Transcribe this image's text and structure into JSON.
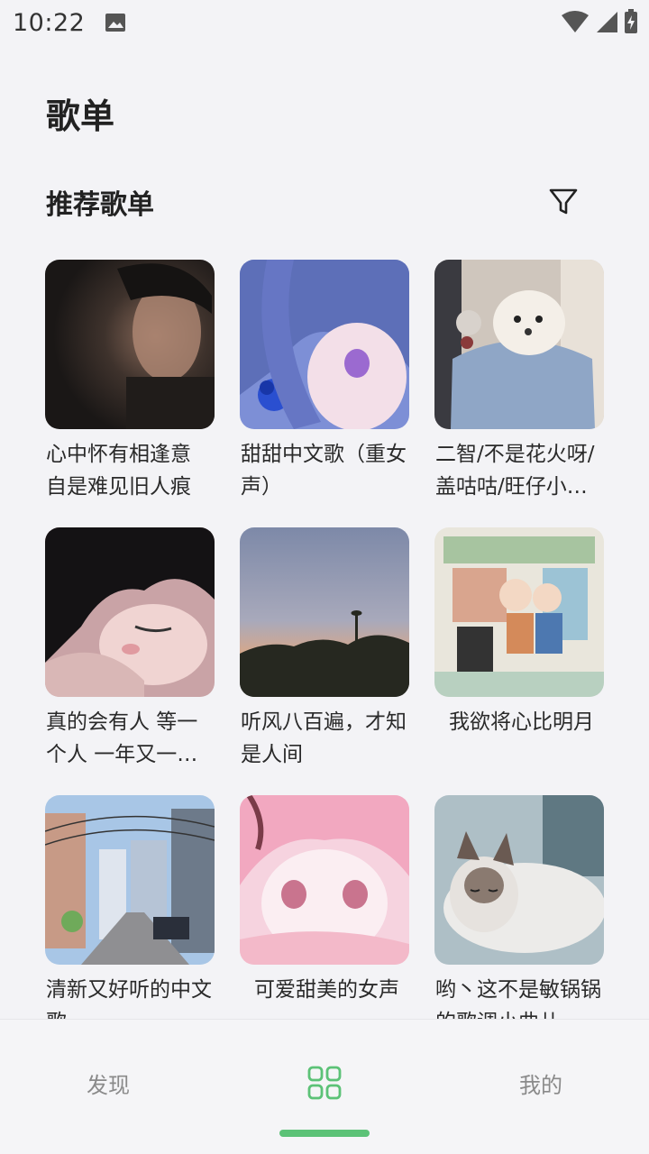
{
  "status_bar": {
    "time": "10:22"
  },
  "header": {
    "title": "歌单"
  },
  "section": {
    "title": "推荐歌单",
    "filter_icon": "filter-icon"
  },
  "playlists": [
    {
      "title": "心中怀有相逢意 自是难见旧人痕"
    },
    {
      "title": "甜甜中文歌（重女声）"
    },
    {
      "title": "二智/不是花火呀/盖咕咕/旺仔小…"
    },
    {
      "title": "真的会有人 等一个人 一年又一…"
    },
    {
      "title": "听风八百遍，才知是人间"
    },
    {
      "title": "我欲将心比明月"
    },
    {
      "title": "清新又好听的中文歌"
    },
    {
      "title": "可爱甜美的女声"
    },
    {
      "title": "哟丶这不是敏锅锅的歌调小曲儿"
    }
  ],
  "bottom_nav": {
    "discover": "发现",
    "playlists_icon": "grid-icon",
    "mine": "我的"
  },
  "colors": {
    "accent": "#5cc277",
    "background": "#f3f3f6"
  }
}
